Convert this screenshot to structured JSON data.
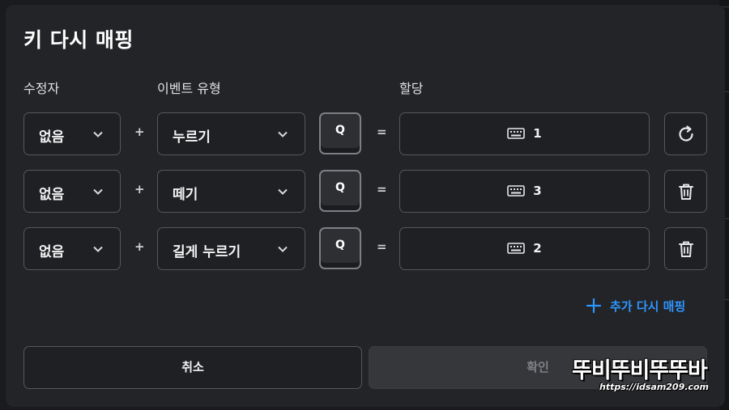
{
  "dialog": {
    "title": "키 다시 매핑",
    "headers": {
      "modifier": "수정자",
      "event_type": "이벤트 유형",
      "assignment": "할당"
    },
    "rows": [
      {
        "modifier": "없음",
        "plus": "+",
        "event": "누르기",
        "key": "Q",
        "equals": "=",
        "assignment": "1",
        "action_icon": "reset-icon"
      },
      {
        "modifier": "없음",
        "plus": "+",
        "event": "떼기",
        "key": "Q",
        "equals": "=",
        "assignment": "3",
        "action_icon": "trash-icon"
      },
      {
        "modifier": "없음",
        "plus": "+",
        "event": "길게 누르기",
        "key": "Q",
        "equals": "=",
        "assignment": "2",
        "action_icon": "trash-icon"
      }
    ],
    "add_remap_label": "추가 다시 매핑",
    "cancel_label": "취소",
    "confirm_label": "확인"
  },
  "watermark": {
    "text": "뚜비뚜비뚜뚜바",
    "url": "https://idsam209.com"
  },
  "colors": {
    "accent": "#2e96ff",
    "dialog_bg": "#232427",
    "field_border": "#55575d",
    "disabled_button": "#36373b"
  }
}
